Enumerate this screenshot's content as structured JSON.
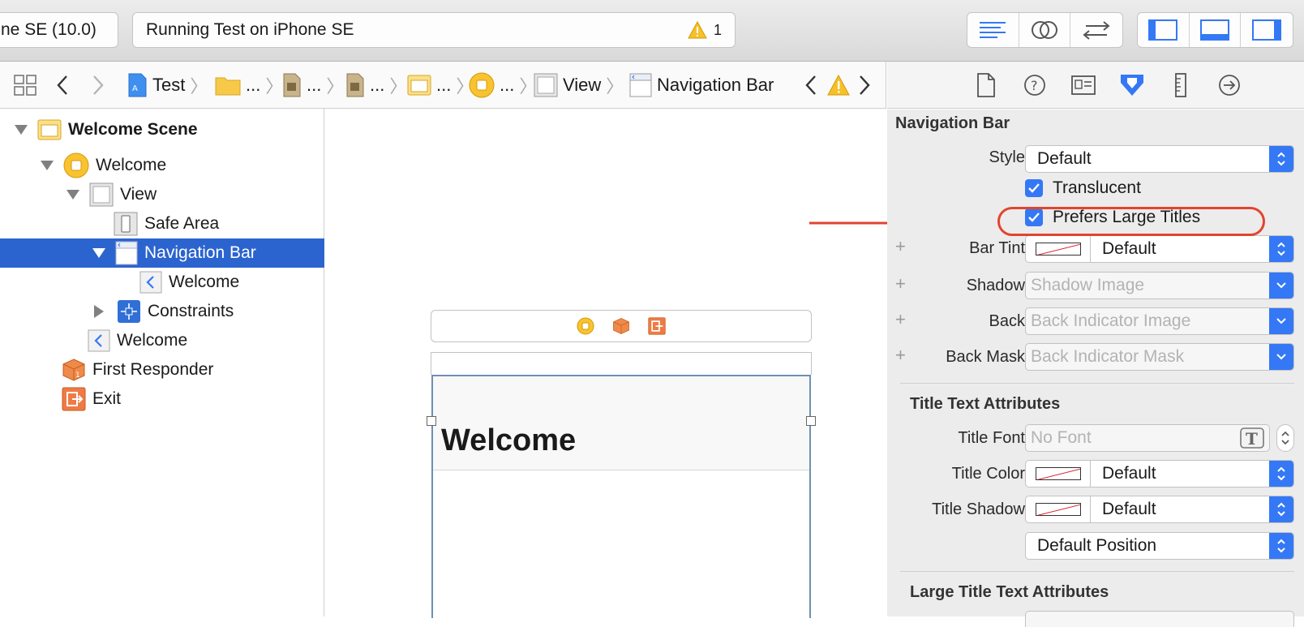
{
  "toolbar": {
    "scheme_label": "ne SE (10.0)",
    "activity_text": "Running Test on iPhone SE",
    "warning_count": "1"
  },
  "jumpbar": {
    "items": [
      {
        "label": "Test"
      },
      {
        "label": "..."
      },
      {
        "label": "..."
      },
      {
        "label": "..."
      },
      {
        "label": "..."
      },
      {
        "label": "..."
      },
      {
        "label": "View"
      },
      {
        "label": "Navigation Bar"
      }
    ]
  },
  "outline": {
    "rows": [
      {
        "label": "Welcome Scene"
      },
      {
        "label": "Welcome"
      },
      {
        "label": "View"
      },
      {
        "label": "Safe Area"
      },
      {
        "label": "Navigation Bar"
      },
      {
        "label": "Welcome"
      },
      {
        "label": "Constraints"
      },
      {
        "label": "Welcome"
      },
      {
        "label": "First Responder"
      },
      {
        "label": "Exit"
      }
    ]
  },
  "canvas": {
    "large_title": "Welcome"
  },
  "inspector": {
    "section_title": "Navigation Bar",
    "style_label": "Style",
    "style_value": "Default",
    "translucent_label": "Translucent",
    "large_titles_label": "Prefers Large Titles",
    "bar_tint_label": "Bar Tint",
    "bar_tint_value": "Default",
    "shadow_label": "Shadow",
    "shadow_placeholder": "Shadow Image",
    "back_label": "Back",
    "back_placeholder": "Back Indicator Image",
    "back_mask_label": "Back Mask",
    "back_mask_placeholder": "Back Indicator Mask",
    "title_attrs_title": "Title Text Attributes",
    "title_font_label": "Title Font",
    "title_font_placeholder": "No Font",
    "title_color_label": "Title Color",
    "title_color_value": "Default",
    "title_shadow_label": "Title Shadow",
    "title_shadow_value": "Default",
    "shadow_offset_value": "Default Position",
    "large_title_attrs_title": "Large Title Text Attributes"
  },
  "colors": {
    "selection": "#2b64cf",
    "accent": "#3478f6",
    "annotation": "#e2442f"
  }
}
